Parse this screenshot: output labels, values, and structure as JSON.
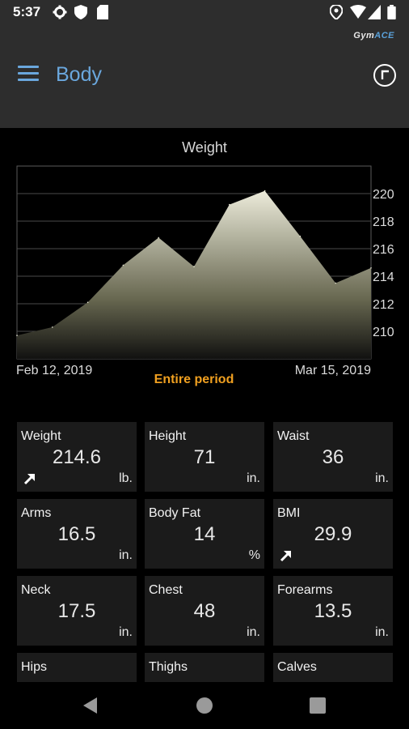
{
  "status_bar": {
    "time": "5:37"
  },
  "app_bar": {
    "brand_prefix": "Gym",
    "brand_suffix": "ACE",
    "title": "Body"
  },
  "chart_data": {
    "type": "area",
    "title": "Weight",
    "x": [
      "Feb 12, 2019",
      "",
      "",
      "",
      "",
      "",
      "",
      "",
      "",
      "",
      "Mar 15, 2019"
    ],
    "y": [
      209.7,
      210.3,
      212.1,
      214.8,
      216.8,
      214.7,
      219.2,
      220.2,
      216.9,
      213.5,
      214.6
    ],
    "ylim": [
      208,
      222
    ],
    "y_ticks": [
      210,
      212,
      214,
      216,
      218,
      220
    ],
    "x_start_label": "Feb 12, 2019",
    "x_end_label": "Mar 15, 2019",
    "grid": true,
    "y_axis_side": "right"
  },
  "period": {
    "label": "Entire period"
  },
  "tiles": [
    {
      "label": "Weight",
      "value": "214.6",
      "unit": "lb.",
      "trend": "up"
    },
    {
      "label": "Height",
      "value": "71",
      "unit": "in.",
      "trend": ""
    },
    {
      "label": "Waist",
      "value": "36",
      "unit": "in.",
      "trend": ""
    },
    {
      "label": "Arms",
      "value": "16.5",
      "unit": "in.",
      "trend": ""
    },
    {
      "label": "Body Fat",
      "value": "14",
      "unit": "%",
      "trend": ""
    },
    {
      "label": "BMI",
      "value": "29.9",
      "unit": "",
      "trend": "up"
    },
    {
      "label": "Neck",
      "value": "17.5",
      "unit": "in.",
      "trend": ""
    },
    {
      "label": "Chest",
      "value": "48",
      "unit": "in.",
      "trend": ""
    },
    {
      "label": "Forearms",
      "value": "13.5",
      "unit": "in.",
      "trend": ""
    },
    {
      "label": "Hips",
      "value": "",
      "unit": "",
      "trend": ""
    },
    {
      "label": "Thighs",
      "value": "",
      "unit": "",
      "trend": ""
    },
    {
      "label": "Calves",
      "value": "",
      "unit": "",
      "trend": ""
    }
  ],
  "colors": {
    "accent": "#6aa7dd",
    "period": "#f0a020",
    "tile_bg": "#1b1b1b",
    "bar_bg": "#2d2d2d"
  }
}
